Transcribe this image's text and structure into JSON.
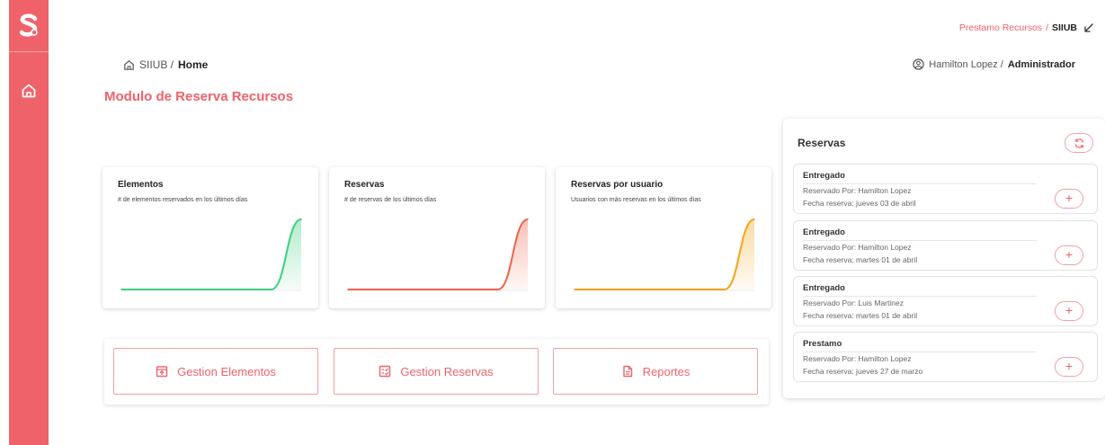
{
  "sidebar": {
    "logo_icon": "s-logo-icon",
    "items": [
      {
        "icon": "home-icon"
      }
    ]
  },
  "topbar": {
    "link": "Prestamo Recursos",
    "separator": "/",
    "current": "SIIUB",
    "icon": "arrow-down-left-icon"
  },
  "breadcrumb": {
    "root": "SIIUB /",
    "current": "Home"
  },
  "user": {
    "name": "Hamilton Lopez /",
    "role": "Administrador"
  },
  "page_title": "Modulo de Reserva Recursos",
  "cards": [
    {
      "title": "Elementos",
      "subtitle": "# de elementos reservados en los últimos días",
      "color": "#3ecf7e"
    },
    {
      "title": "Reservas",
      "subtitle": "# de reservas de los últimos días",
      "color": "#f0624a"
    },
    {
      "title": "Reservas por usuario",
      "subtitle": "Usuarios con más reservas en los últimos días",
      "color": "#f4a419"
    }
  ],
  "chart_data": [
    {
      "type": "area",
      "x": [
        1,
        2,
        3,
        4,
        5,
        6,
        7
      ],
      "series": [
        {
          "values": [
            0,
            0,
            0,
            0,
            0,
            0,
            1
          ]
        }
      ]
    },
    {
      "type": "area",
      "x": [
        1,
        2,
        3,
        4,
        5,
        6,
        7
      ],
      "series": [
        {
          "values": [
            0,
            0,
            0,
            0,
            0,
            0,
            1
          ]
        }
      ]
    },
    {
      "type": "area",
      "x": [
        1,
        2,
        3,
        4,
        5,
        6,
        7
      ],
      "series": [
        {
          "values": [
            0,
            0,
            0,
            0,
            0,
            0,
            1
          ]
        }
      ]
    }
  ],
  "actions": [
    {
      "label": "Gestion Elementos",
      "icon": "box-upload-icon"
    },
    {
      "label": "Gestion Reservas",
      "icon": "checklist-icon"
    },
    {
      "label": "Reportes",
      "icon": "document-icon"
    }
  ],
  "reservas": {
    "title": "Reservas",
    "refresh_icon": "refresh-icon",
    "items": [
      {
        "status": "Entregado",
        "by": "Reservado Por: Hamilton Lopez",
        "date": "Fecha reserva: jueves 03 de abril",
        "action": "+"
      },
      {
        "status": "Entregado",
        "by": "Reservado Por: Hamilton Lopez",
        "date": "Fecha reserva: martes 01 de abril",
        "action": "+"
      },
      {
        "status": "Entregado",
        "by": "Reservado Por: Luis Martinez",
        "date": "Fecha reserva: martes 01 de abril",
        "action": "+"
      },
      {
        "status": "Prestamo",
        "by": "Reservado Por: Hamilton Lopez",
        "date": "Fecha reserva: jueves 27 de marzo",
        "action": "+"
      }
    ]
  },
  "colors": {
    "accent": "#f0626a",
    "accent_border": "#f0a0a4"
  }
}
